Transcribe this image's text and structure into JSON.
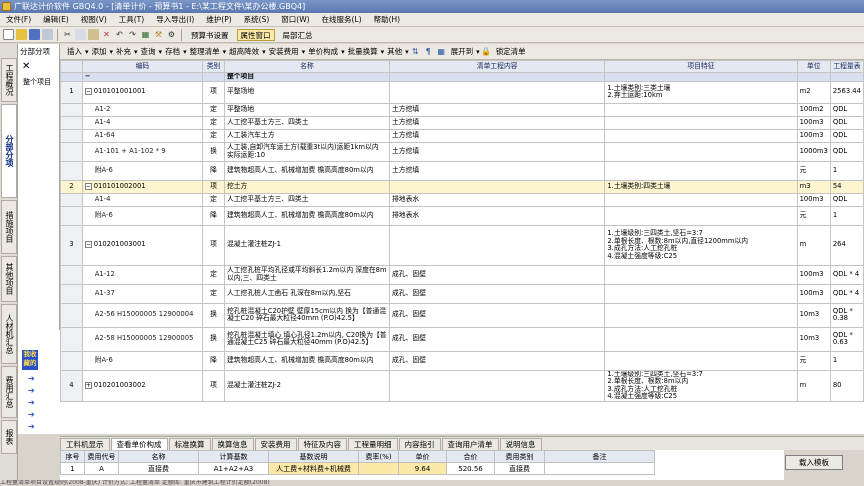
{
  "app": {
    "title": "广联达计价软件 GBQ4.0 - [清单计价 - 预算书1 - E:\\某工程文件\\某办公楼.GBQ4]"
  },
  "menu": [
    "文件(F)",
    "编辑(E)",
    "视图(V)",
    "工具(T)",
    "导入导出(I)",
    "维护(P)",
    "系统(S)",
    "窗口(W)",
    "在线服务(L)",
    "帮助(H)"
  ],
  "toolbar1": {
    "budget_settings": "预算书设置",
    "property_window": "属性窗口",
    "partial_summary": "局部汇总"
  },
  "side_tabs": [
    "工程概况",
    "分部分项",
    "措施项目",
    "其他项目",
    "人材机汇总",
    "费用汇总",
    "报表"
  ],
  "tree": {
    "title": "分部分项",
    "root": "整个项目",
    "favorites": "我收藏的"
  },
  "toolbar2": [
    "插入",
    "添加",
    "补充",
    "查询",
    "存档",
    "整理清单",
    "超高降效",
    "安装费用",
    "单价构成",
    "批量换算",
    "其他",
    "展开到",
    "锁定清单"
  ],
  "columns": [
    "编码",
    "类别",
    "名称",
    "清单工程内容",
    "项目特征",
    "单位",
    "工程量表"
  ],
  "header_row": {
    "name": "整个项目"
  },
  "rows": [
    {
      "num": "1",
      "code": "010101001001",
      "type": "项",
      "name": "平整场地",
      "content": "",
      "feature": "1.土壤类别:三类土壤\n2.弃土运距:10km",
      "unit": "m2",
      "qty": "2563.44",
      "level": 0
    },
    {
      "num": "",
      "code": "A1-2",
      "type": "定",
      "name": "平整场地",
      "content": "土方挖填",
      "feature": "",
      "unit": "100m2",
      "qty": "QDL",
      "level": 1
    },
    {
      "num": "",
      "code": "A1-4",
      "type": "定",
      "name": "人工挖平基土方三、四类土",
      "content": "土方挖填",
      "feature": "",
      "unit": "100m3",
      "qty": "QDL",
      "level": 1
    },
    {
      "num": "",
      "code": "A1-64",
      "type": "定",
      "name": "人工装汽车土方",
      "content": "土方挖填",
      "feature": "",
      "unit": "100m3",
      "qty": "QDL",
      "level": 1
    },
    {
      "num": "",
      "code": "A1-101 + A1-102 * 9",
      "type": "换",
      "name": "人工装,自卸汽车运土方(载重3t以内)运距1km以内 实际运距:10",
      "content": "土方挖填",
      "feature": "",
      "unit": "1000m3",
      "qty": "QDL",
      "level": 1
    },
    {
      "num": "",
      "code": "附A-6",
      "type": "降",
      "name": "建筑物超高人工、机械增加费 檐高高度80m以内",
      "content": "土方挖填",
      "feature": "",
      "unit": "元",
      "qty": "1",
      "level": 1
    },
    {
      "num": "2",
      "code": "010101002001",
      "type": "项",
      "name": "挖土方",
      "content": "",
      "feature": "1.土壤类别:四类土壤",
      "unit": "m3",
      "qty": "54",
      "level": 0,
      "selected": true
    },
    {
      "num": "",
      "code": "A1-4",
      "type": "定",
      "name": "人工挖平基土方三、四类土",
      "content": "排地表水",
      "feature": "",
      "unit": "100m3",
      "qty": "QDL",
      "level": 1
    },
    {
      "num": "",
      "code": "附A-6",
      "type": "降",
      "name": "建筑物超高人工、机械增加费 檐高高度80m以内",
      "content": "排地表水",
      "feature": "",
      "unit": "元",
      "qty": "1",
      "level": 1
    },
    {
      "num": "3",
      "code": "010201003001",
      "type": "项",
      "name": "混凝土灌注桩ZJ-1",
      "content": "",
      "feature": "1.土壤级别:三四类土,坚石=3:7\n2.单根长度、根数:8m以内,直径1200mm以内\n3.成孔方法:人工挖孔桩\n4.混凝土强度等级:C25",
      "unit": "m",
      "qty": "264",
      "level": 0
    },
    {
      "num": "",
      "code": "A1-12",
      "type": "定",
      "name": "人工挖孔桩平均孔径或平均斜长1.2m以内 深度在8m以内,三、四类土",
      "content": "成孔、固壁",
      "feature": "",
      "unit": "100m3",
      "qty": "QDL * 4",
      "level": 1
    },
    {
      "num": "",
      "code": "A1-37",
      "type": "定",
      "name": "人工挖孔桩人工凿石 孔深在8m以内,坚石",
      "content": "成孔、固壁",
      "feature": "",
      "unit": "100m3",
      "qty": "QDL * 4",
      "level": 1
    },
    {
      "num": "",
      "code": "A2-56 H15000005 12900004",
      "type": "换",
      "name": "挖孔桩混凝土C20护壁 壁厚15cm以内 换为【普通混凝土C20 碎石最大粒径40mm (P.O)42.5】",
      "content": "成孔、固壁",
      "feature": "",
      "unit": "10m3",
      "qty": "QDL * 0.38",
      "level": 1
    },
    {
      "num": "",
      "code": "A2-58 H15000005 12900005",
      "type": "换",
      "name": "挖孔桩混凝土填心 填心孔径1.2m以内, C20换为【普通混凝土C25 碎石最大粒径40mm (P.O)42.5】",
      "content": "成孔、固壁",
      "feature": "",
      "unit": "10m3",
      "qty": "QDL * 0.63",
      "level": 1
    },
    {
      "num": "",
      "code": "附A-6",
      "type": "降",
      "name": "建筑物超高人工、机械增加费 檐高高度80m以内",
      "content": "成孔、固壁",
      "feature": "",
      "unit": "元",
      "qty": "1",
      "level": 1
    },
    {
      "num": "4",
      "code": "010201003002",
      "type": "项",
      "name": "混凝土灌注桩ZJ-2",
      "content": "",
      "feature": "1.土壤级别:三四类土,坚石=3:7\n2.单根长度、根数:8m以内\n3.成孔方法:人工挖孔桩\n4.混凝土强度等级:C25",
      "unit": "m",
      "qty": "80",
      "level": 0,
      "collapsed": true
    }
  ],
  "bottom_tabs": [
    "工料机显示",
    "查看单价构成",
    "标准换算",
    "换算信息",
    "安装费用",
    "特征及内容",
    "工程量明细",
    "内容指引",
    "查询用户清单",
    "说明信息"
  ],
  "fee_table": {
    "headers": [
      "序号",
      "费用代号",
      "名称",
      "计算基数",
      "基数说明",
      "费率(%)",
      "单价",
      "合价",
      "费用类别",
      "备注"
    ],
    "row": [
      "1",
      "A",
      "直接费",
      "A1+A2+A3",
      "人工费+材料费+机械费",
      "",
      "9.64",
      "520.56",
      "直接费",
      ""
    ]
  },
  "load_template_button": "载入模板",
  "status": "工程量清单项目设置规则(2008-重庆)    计价方式: 工程量清单    定额库: 重庆市建筑工程计价定额(2008)"
}
